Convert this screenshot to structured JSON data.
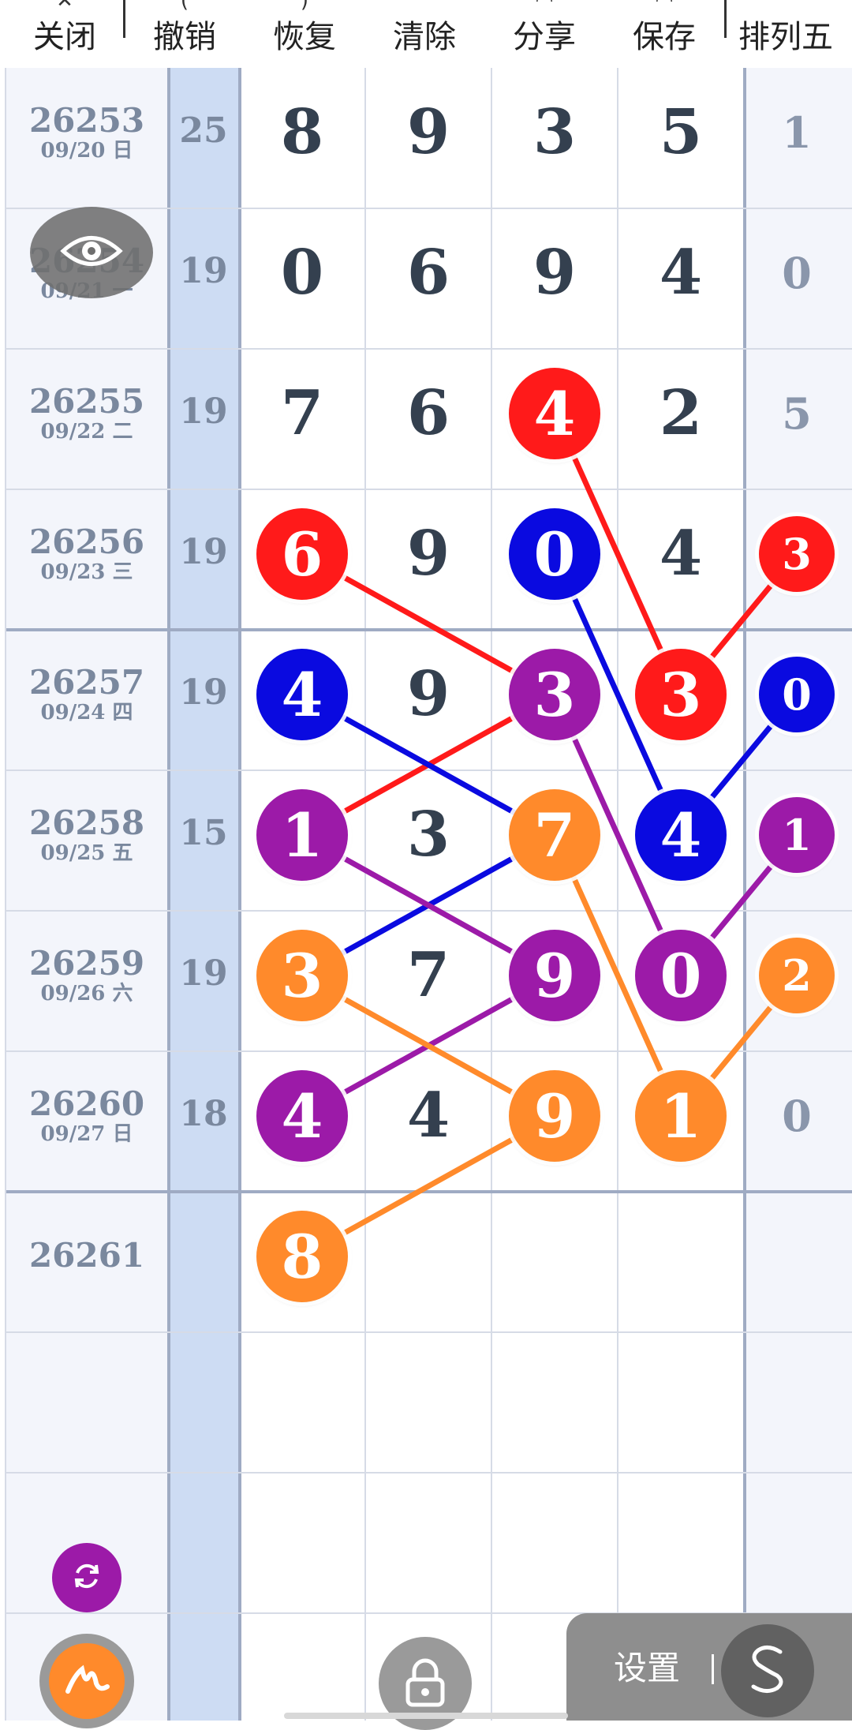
{
  "toolbar": {
    "items": [
      {
        "label": "关闭",
        "icon": "close-icon"
      },
      {
        "label": "撤销",
        "icon": "undo-icon"
      },
      {
        "label": "恢复",
        "icon": "redo-icon"
      },
      {
        "label": "清除",
        "icon": "clear-icon"
      },
      {
        "label": "分享",
        "icon": "share-icon"
      },
      {
        "label": "保存",
        "icon": "save-icon"
      },
      {
        "label": "排列五",
        "icon": ""
      }
    ]
  },
  "rows": [
    {
      "issue": "26253",
      "date": "09/20 日",
      "sum": "25",
      "digits": [
        "8",
        "9",
        "3",
        "5"
      ],
      "p5": "1"
    },
    {
      "issue": "26254",
      "date": "09/21 一",
      "sum": "19",
      "digits": [
        "0",
        "6",
        "9",
        "4"
      ],
      "p5": "0"
    },
    {
      "issue": "26255",
      "date": "09/22 二",
      "sum": "19",
      "digits": [
        "7",
        "6",
        "4",
        "2"
      ],
      "p5": "5"
    },
    {
      "issue": "26256",
      "date": "09/23 三",
      "sum": "19",
      "digits": [
        "6",
        "9",
        "0",
        "4"
      ],
      "p5": "3"
    },
    {
      "issue": "26257",
      "date": "09/24 四",
      "sum": "19",
      "digits": [
        "4",
        "9",
        "3",
        "3"
      ],
      "p5": "0"
    },
    {
      "issue": "26258",
      "date": "09/25 五",
      "sum": "15",
      "digits": [
        "1",
        "3",
        "7",
        "4"
      ],
      "p5": "1"
    },
    {
      "issue": "26259",
      "date": "09/26 六",
      "sum": "19",
      "digits": [
        "3",
        "7",
        "9",
        "0"
      ],
      "p5": "2"
    },
    {
      "issue": "26260",
      "date": "09/27 日",
      "sum": "18",
      "digits": [
        "4",
        "4",
        "9",
        "1"
      ],
      "p5": "0"
    },
    {
      "issue": "26261",
      "date": "",
      "sum": "",
      "digits": [
        "8",
        "",
        "",
        ""
      ],
      "p5": ""
    }
  ],
  "marks": [
    {
      "row": 2,
      "col": 2,
      "color": "red"
    },
    {
      "row": 3,
      "col": 0,
      "color": "red"
    },
    {
      "row": 3,
      "col": 2,
      "color": "blue"
    },
    {
      "row": 3,
      "col": 4,
      "color": "red"
    },
    {
      "row": 4,
      "col": 0,
      "color": "blue"
    },
    {
      "row": 4,
      "col": 2,
      "color": "purple"
    },
    {
      "row": 4,
      "col": 3,
      "color": "red"
    },
    {
      "row": 4,
      "col": 4,
      "color": "blue"
    },
    {
      "row": 5,
      "col": 0,
      "color": "purple"
    },
    {
      "row": 5,
      "col": 2,
      "color": "orange"
    },
    {
      "row": 5,
      "col": 3,
      "color": "blue"
    },
    {
      "row": 5,
      "col": 4,
      "color": "purple"
    },
    {
      "row": 6,
      "col": 0,
      "color": "orange"
    },
    {
      "row": 6,
      "col": 2,
      "color": "purple"
    },
    {
      "row": 6,
      "col": 3,
      "color": "purple"
    },
    {
      "row": 6,
      "col": 4,
      "color": "orange"
    },
    {
      "row": 7,
      "col": 0,
      "color": "purple"
    },
    {
      "row": 7,
      "col": 2,
      "color": "orange"
    },
    {
      "row": 7,
      "col": 3,
      "color": "orange"
    },
    {
      "row": 8,
      "col": 0,
      "color": "orange"
    }
  ],
  "links": [
    {
      "from": [
        3,
        0
      ],
      "to": [
        4,
        2
      ],
      "color": "red"
    },
    {
      "from": [
        4,
        2
      ],
      "to": [
        5,
        0
      ],
      "color": "red"
    },
    {
      "from": [
        2,
        2
      ],
      "to": [
        4,
        3
      ],
      "color": "red"
    },
    {
      "from": [
        4,
        3
      ],
      "to": [
        3,
        4
      ],
      "color": "red"
    },
    {
      "from": [
        3,
        2
      ],
      "to": [
        5,
        3
      ],
      "color": "blue"
    },
    {
      "from": [
        5,
        3
      ],
      "to": [
        4,
        4
      ],
      "color": "blue"
    },
    {
      "from": [
        4,
        0
      ],
      "to": [
        5,
        2
      ],
      "color": "blue"
    },
    {
      "from": [
        5,
        2
      ],
      "to": [
        6,
        0
      ],
      "color": "blue"
    },
    {
      "from": [
        5,
        0
      ],
      "to": [
        6,
        2
      ],
      "color": "purple"
    },
    {
      "from": [
        6,
        2
      ],
      "to": [
        7,
        0
      ],
      "color": "purple"
    },
    {
      "from": [
        4,
        2
      ],
      "to": [
        6,
        3
      ],
      "color": "purple"
    },
    {
      "from": [
        6,
        3
      ],
      "to": [
        5,
        4
      ],
      "color": "purple"
    },
    {
      "from": [
        6,
        0
      ],
      "to": [
        7,
        2
      ],
      "color": "orange"
    },
    {
      "from": [
        7,
        2
      ],
      "to": [
        8,
        0
      ],
      "color": "orange"
    },
    {
      "from": [
        5,
        2
      ],
      "to": [
        7,
        3
      ],
      "color": "orange"
    },
    {
      "from": [
        7,
        3
      ],
      "to": [
        6,
        4
      ],
      "color": "orange"
    }
  ],
  "palette": {
    "red": "#ff1a1a",
    "blue": "#0a0ae0",
    "purple": "#9c1aa8",
    "orange": "#ff8a2b",
    "sum_column_bg": "#cddcf3",
    "issue_column_bg": "#f3f5fb",
    "p5_column_bg": "#f3f5fb"
  },
  "controls": {
    "eye_icon": "eye-icon",
    "refresh_icon": "refresh-icon",
    "pen_icon": "pen-icon",
    "lock_icon": "lock-icon",
    "settings_label": "设置",
    "s_icon": "s-icon"
  }
}
